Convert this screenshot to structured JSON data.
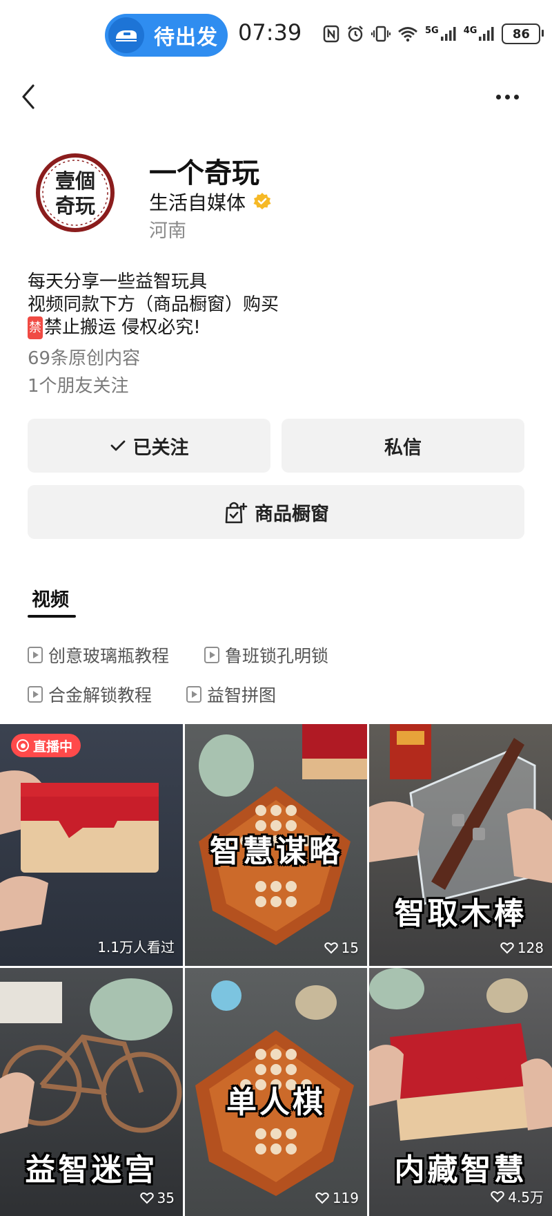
{
  "status_bar": {
    "trip_label": "待出发",
    "time": "07:39",
    "network_5g": "5G",
    "network_4g": "4G",
    "battery": "86"
  },
  "profile": {
    "name": "一个奇玩",
    "category": "生活自媒体",
    "location": "河南",
    "avatar_text": [
      "壹個",
      "奇玩"
    ]
  },
  "bio": {
    "line1": "每天分享一些益智玩具",
    "line2": "视频同款下方（商品橱窗）购买",
    "ban_badge": "禁",
    "line3": "禁止搬运 侵权必究!"
  },
  "stats": {
    "original": "69条原创内容",
    "friends": "1个朋友关注"
  },
  "actions": {
    "follow": "已关注",
    "message": "私信",
    "shop": "商品橱窗"
  },
  "tabs": {
    "video": "视频"
  },
  "collections": [
    "创意玻璃瓶教程",
    "鲁班锁孔明锁",
    "合金解锁教程",
    "益智拼图"
  ],
  "videos": [
    {
      "title": "",
      "stat": "1.1万人看过",
      "live": "直播中",
      "stat_type": "views"
    },
    {
      "title": "智慧谋略",
      "stat": "15",
      "stat_type": "likes"
    },
    {
      "title": "智取木棒",
      "stat": "128",
      "stat_type": "likes"
    },
    {
      "title": "益智迷宫",
      "stat": "35",
      "stat_type": "likes"
    },
    {
      "title": "单人棋",
      "stat": "119",
      "stat_type": "likes"
    },
    {
      "title": "内藏智慧",
      "stat": "4.5万",
      "stat_type": "likes"
    }
  ],
  "colors": {
    "trip_pill": "#2f8df0",
    "live_badge": "#ff4a4a",
    "verified": "#f6b926",
    "button_bg": "#f2f2f2"
  }
}
